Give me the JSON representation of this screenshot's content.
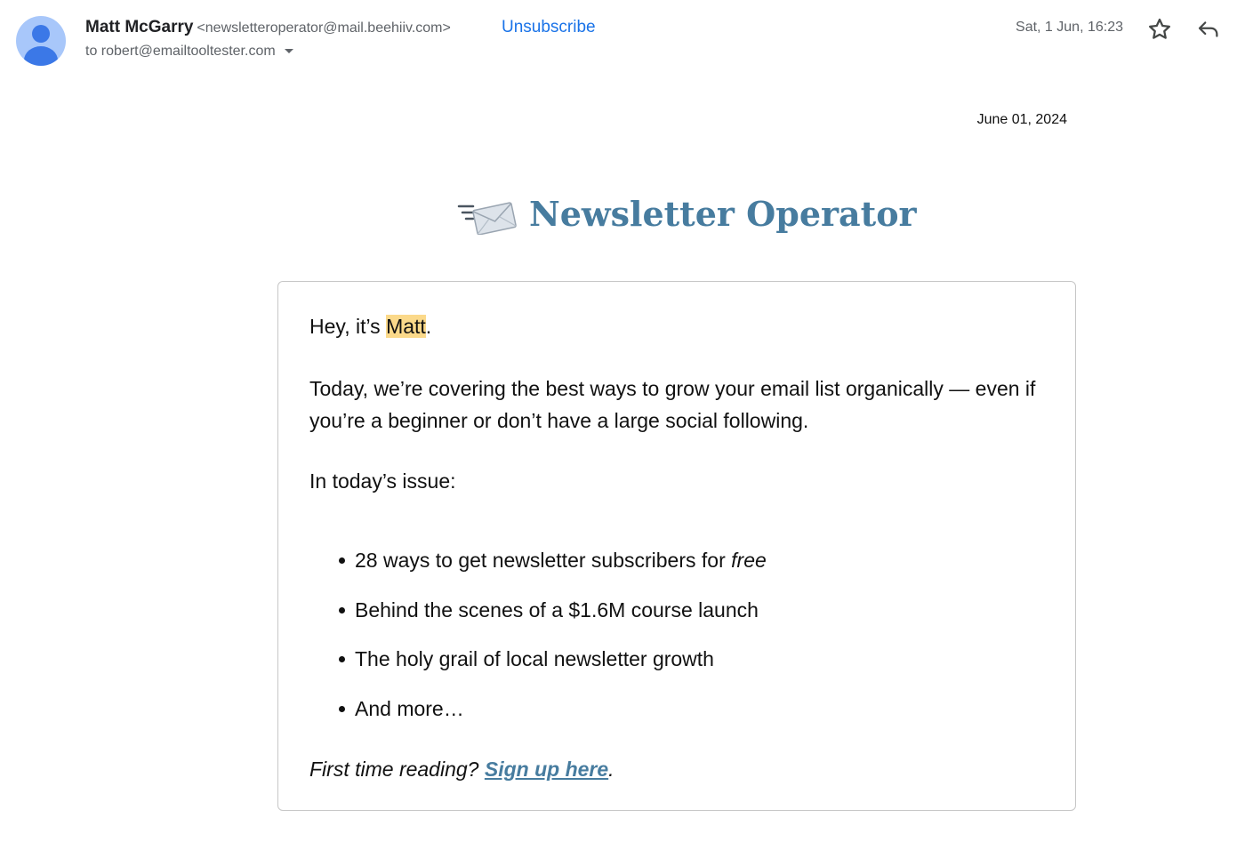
{
  "header": {
    "sender_name": "Matt McGarry",
    "sender_email": "<newsletteroperator@mail.beehiiv.com>",
    "unsubscribe_label": "Unsubscribe",
    "recipient": "to robert@emailtooltester.com",
    "received": "Sat, 1 Jun, 16:23",
    "star_icon": "star-outline-icon",
    "reply_icon": "reply-icon"
  },
  "newsletter": {
    "date": "June 01, 2024",
    "brand_name": "Newsletter Operator",
    "brand_icon": "envelope-speed-icon",
    "brand_color": "#477c9f",
    "greeting_prefix": "Hey, it’s ",
    "greeting_name": "Matt",
    "greeting_suffix": ".",
    "intro": "Today, we’re covering the best ways to grow your email list organically — even if you’re a beginner or don’t have a large social following.",
    "issue_heading": "In today’s issue:",
    "bullets": {
      "first_prefix": "28 ways to get newsletter subscribers for ",
      "first_emphasis": "free",
      "second": "Behind the scenes of a $1.6M course launch",
      "third": "The holy grail of local newsletter growth",
      "fourth": "And more…"
    },
    "footer_prefix": "First time reading? ",
    "signup_label": "Sign up here",
    "footer_suffix": "."
  }
}
